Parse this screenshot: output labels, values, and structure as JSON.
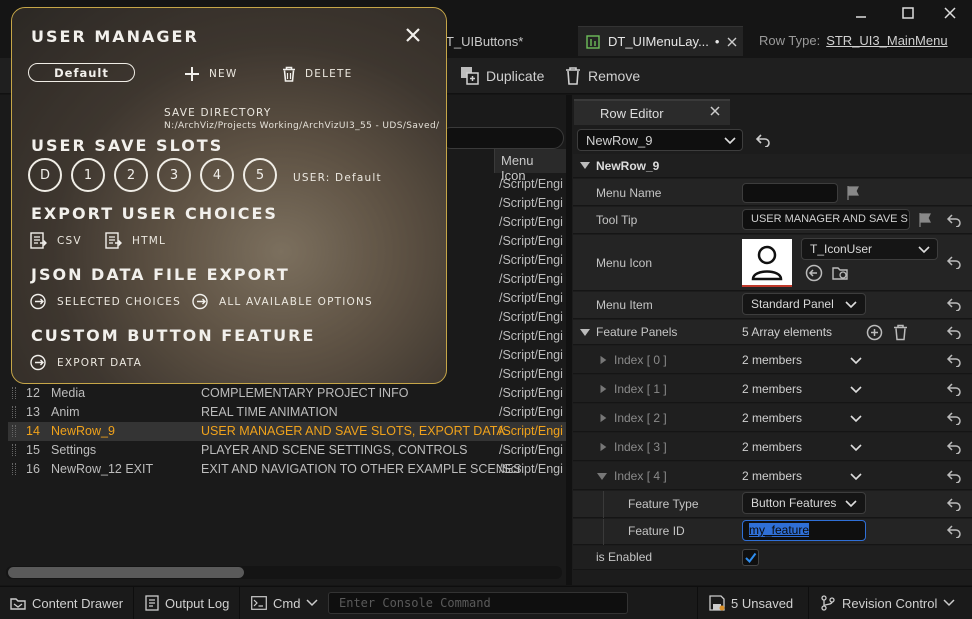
{
  "tabs": {
    "background_tab": "T_UIButtons*",
    "active_tab": "DT_UIMenuLay...",
    "active_tab_modified": "•",
    "row_type_label": "Row Type:",
    "row_type_value": "STR_UI3_MainMenu"
  },
  "toolbar": {
    "duplicate_label": "Duplicate",
    "remove_label": "Remove"
  },
  "table": {
    "col_menu_icon": "Menu Icon",
    "icon_path_only_rows": [
      "/Script/Engi",
      "/Script/Engi",
      "/Script/Engi",
      "/Script/Engi",
      "/Script/Engi",
      "/Script/Engi",
      "/Script/Engi",
      "/Script/Engi",
      "/Script/Engi",
      "/Script/Engi",
      "/Script/Engi"
    ],
    "rows": [
      {
        "index": "12",
        "row_name": "Media",
        "menu_name": "COMPLEMENTARY PROJECT INFO",
        "menu_icon": "/Script/Engi"
      },
      {
        "index": "13",
        "row_name": "Anim",
        "menu_name": "REAL TIME ANIMATION",
        "menu_icon": "/Script/Engi"
      },
      {
        "index": "14",
        "row_name": "NewRow_9",
        "menu_name": "USER MANAGER AND SAVE SLOTS, EXPORT DATA",
        "menu_icon": "/Script/Engi"
      },
      {
        "index": "15",
        "row_name": "Settings",
        "menu_name": "PLAYER AND SCENE SETTINGS, CONTROLS",
        "menu_icon": "/Script/Engi"
      },
      {
        "index": "16",
        "row_name": "NewRow_12 EXIT",
        "menu_name": "EXIT AND NAVIGATION TO OTHER EXAMPLE SCENES",
        "menu_icon": "/Script/Engi"
      }
    ]
  },
  "row_editor": {
    "tab_label": "Row Editor",
    "selected_row": "NewRow_9",
    "section_title": "NewRow_9",
    "menu_name_label": "Menu Name",
    "menu_name_value": "",
    "tool_tip_label": "Tool Tip",
    "tool_tip_value": "USER MANAGER AND SAVE S",
    "menu_icon_label": "Menu Icon",
    "menu_icon_asset": "T_IconUser",
    "menu_item_label": "Menu Item",
    "menu_item_value": "Standard Panel",
    "feature_panels_label": "Feature Panels",
    "feature_panels_value": "5 Array elements",
    "indices": [
      {
        "label": "Index [ 0 ]",
        "value": "2 members"
      },
      {
        "label": "Index [ 1 ]",
        "value": "2 members"
      },
      {
        "label": "Index [ 2 ]",
        "value": "2 members"
      },
      {
        "label": "Index [ 3 ]",
        "value": "2 members"
      },
      {
        "label": "Index [ 4 ]",
        "value": "2 members"
      }
    ],
    "feature_type_label": "Feature Type",
    "feature_type_value": "Button Features",
    "feature_id_label": "Feature ID",
    "feature_id_value": "my_feature",
    "is_enabled_label": "is Enabled",
    "is_enabled_checked": true
  },
  "status_bar": {
    "content_drawer": "Content Drawer",
    "output_log": "Output Log",
    "cmd": "Cmd",
    "console_placeholder": "Enter Console Command",
    "unsaved": "5 Unsaved",
    "revision_control": "Revision Control"
  },
  "user_manager": {
    "title": "USER MANAGER",
    "default_button": "Default",
    "new_label": "NEW",
    "delete_label": "DELETE",
    "save_directory_label": "SAVE DIRECTORY",
    "save_directory_path": "N:/ArchViz/Projects Working/ArchVizUI3_55 - UDS/Saved/",
    "save_slots_title": "USER SAVE SLOTS",
    "slots": [
      "D",
      "1",
      "2",
      "3",
      "4",
      "5"
    ],
    "current_user": "USER: Default",
    "export_choices_title": "EXPORT USER CHOICES",
    "csv_label": "CSV",
    "html_label": "HTML",
    "json_title": "JSON DATA FILE EXPORT",
    "selected_choices_label": "SELECTED CHOICES",
    "all_options_label": "ALL AVAILABLE OPTIONS",
    "custom_title": "CUSTOM BUTTON FEATURE",
    "export_data_label": "EXPORT DATA"
  },
  "colors": {
    "accent_selected": "#f0a21b",
    "overlay_border": "#c6a648",
    "field_highlight": "#2f6fd6"
  }
}
